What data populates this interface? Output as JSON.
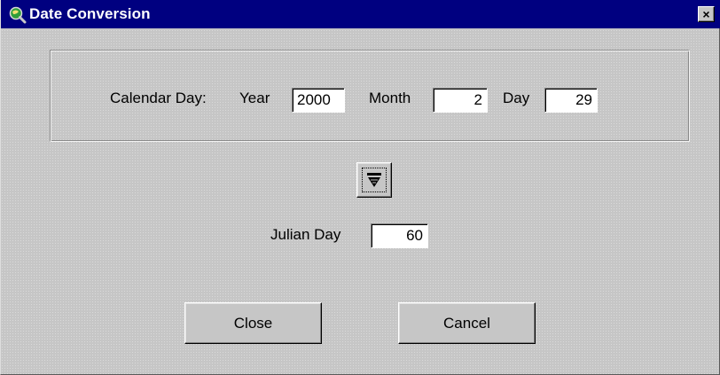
{
  "window": {
    "title": "Date Conversion",
    "close_label": "×"
  },
  "calendar": {
    "label": "Calendar Day:",
    "year_label": "Year",
    "year_value": "2000",
    "month_label": "Month",
    "month_value": "2",
    "day_label": "Day",
    "day_value": "29"
  },
  "convert_button": {
    "icon": "arrow-down-icon"
  },
  "julian": {
    "label": "Julian Day",
    "value": "60"
  },
  "buttons": {
    "close_label": "Close",
    "cancel_label": "Cancel"
  },
  "colors": {
    "titlebar": "#000080",
    "window_bg": "#c6c6c6",
    "title_text": "#ffffff"
  }
}
